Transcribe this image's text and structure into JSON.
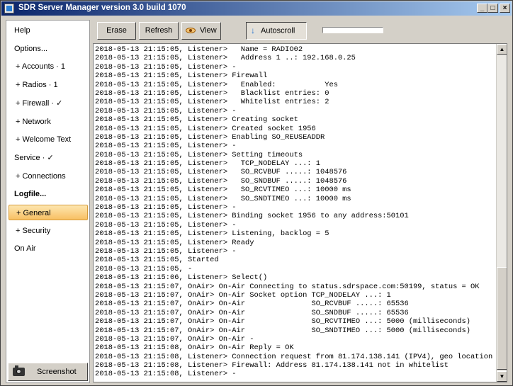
{
  "window": {
    "title": "SDR Server Manager version 3.0 build 1070",
    "controls": {
      "minimize": "_",
      "maximize": "□",
      "close": "×"
    }
  },
  "sidebar": {
    "items": [
      {
        "label": "Help",
        "level": 0,
        "selected": false,
        "bold": false
      },
      {
        "label": "Options...",
        "level": 0,
        "selected": false,
        "bold": false
      },
      {
        "label": "+ Accounts · 1",
        "level": 1,
        "selected": false,
        "bold": false
      },
      {
        "label": "+ Radios · 1",
        "level": 1,
        "selected": false,
        "bold": false
      },
      {
        "label": "+ Firewall · ✓",
        "level": 1,
        "selected": false,
        "bold": false
      },
      {
        "label": "+ Network",
        "level": 1,
        "selected": false,
        "bold": false
      },
      {
        "label": "+ Welcome Text",
        "level": 1,
        "selected": false,
        "bold": false
      },
      {
        "label": "Service · ✓",
        "level": 0,
        "selected": false,
        "bold": false
      },
      {
        "label": "+ Connections",
        "level": 1,
        "selected": false,
        "bold": false
      },
      {
        "label": "Logfile...",
        "level": 0,
        "selected": false,
        "bold": true
      },
      {
        "label": "+ General",
        "level": 1,
        "selected": true,
        "bold": false
      },
      {
        "label": "+ Security",
        "level": 1,
        "selected": false,
        "bold": false
      },
      {
        "label": "On Air",
        "level": 0,
        "selected": false,
        "bold": false
      }
    ],
    "screenshot_label": "Screenshot",
    "screenshot_icon": "camera-icon"
  },
  "toolbar": {
    "erase_label": "Erase",
    "refresh_label": "Refresh",
    "view_label": "View",
    "view_icon": "eye-icon",
    "autoscroll_label": "Autoscroll",
    "autoscroll_icon": "down-arrow-icon",
    "autoscroll_active": true,
    "progress_fraction": 0.0
  },
  "log": {
    "lines": [
      "2018-05-13 21:15:05, Listener>   Name = RADIO02",
      "2018-05-13 21:15:05, Listener>   Address 1 ..: 192.168.0.25",
      "2018-05-13 21:15:05, Listener> -",
      "2018-05-13 21:15:05, Listener> Firewall",
      "2018-05-13 21:15:05, Listener>   Enabled:           Yes",
      "2018-05-13 21:15:05, Listener>   Blacklist entries: 0",
      "2018-05-13 21:15:05, Listener>   Whitelist entries: 2",
      "2018-05-13 21:15:05, Listener> -",
      "2018-05-13 21:15:05, Listener> Creating socket",
      "2018-05-13 21:15:05, Listener> Created socket 1956",
      "2018-05-13 21:15:05, Listener> Enabling SO_REUSEADDR",
      "2018-05-13 21:15:05, Listener> -",
      "2018-05-13 21:15:05, Listener> Setting timeouts",
      "2018-05-13 21:15:05, Listener>   TCP_NODELAY ...: 1",
      "2018-05-13 21:15:05, Listener>   SO_RCVBUF .....: 1048576",
      "2018-05-13 21:15:05, Listener>   SO_SNDBUF .....: 1048576",
      "2018-05-13 21:15:05, Listener>   SO_RCVTIMEO ...: 10000 ms",
      "2018-05-13 21:15:05, Listener>   SO_SNDTIMEO ...: 10000 ms",
      "2018-05-13 21:15:05, Listener> -",
      "2018-05-13 21:15:05, Listener> Binding socket 1956 to any address:50101",
      "2018-05-13 21:15:05, Listener> -",
      "2018-05-13 21:15:05, Listener> Listening, backlog = 5",
      "2018-05-13 21:15:05, Listener> Ready",
      "2018-05-13 21:15:05, Listener> -",
      "2018-05-13 21:15:05, Started",
      "2018-05-13 21:15:05, -",
      "2018-05-13 21:15:06, Listener> Select()",
      "2018-05-13 21:15:07, OnAir> On-Air Connecting to status.sdrspace.com:50199, status = OK",
      "2018-05-13 21:15:07, OnAir> On-Air Socket option TCP_NODELAY ...: 1",
      "2018-05-13 21:15:07, OnAir> On-Air               SO_RCVBUF .....: 65536",
      "2018-05-13 21:15:07, OnAir> On-Air               SO_SNDBUF .....: 65536",
      "2018-05-13 21:15:07, OnAir> On-Air               SO_RCVTIMEO ...: 5000 (milliseconds)",
      "2018-05-13 21:15:07, OnAir> On-Air               SO_SNDTIMEO ...: 5000 (milliseconds)",
      "2018-05-13 21:15:07, OnAir> On-Air -",
      "2018-05-13 21:15:08, OnAir> On-Air Reply = OK",
      "2018-05-13 21:15:08, Listener> Connection request from 81.174.138.141 (IPV4), geo location = United",
      "2018-05-13 21:15:08, Listener> Firewall: Address 81.174.138.141 not in whitelist",
      "2018-05-13 21:15:08, Listener> -"
    ]
  },
  "scrollbar": {
    "up_glyph": "▲",
    "down_glyph": "▼"
  }
}
